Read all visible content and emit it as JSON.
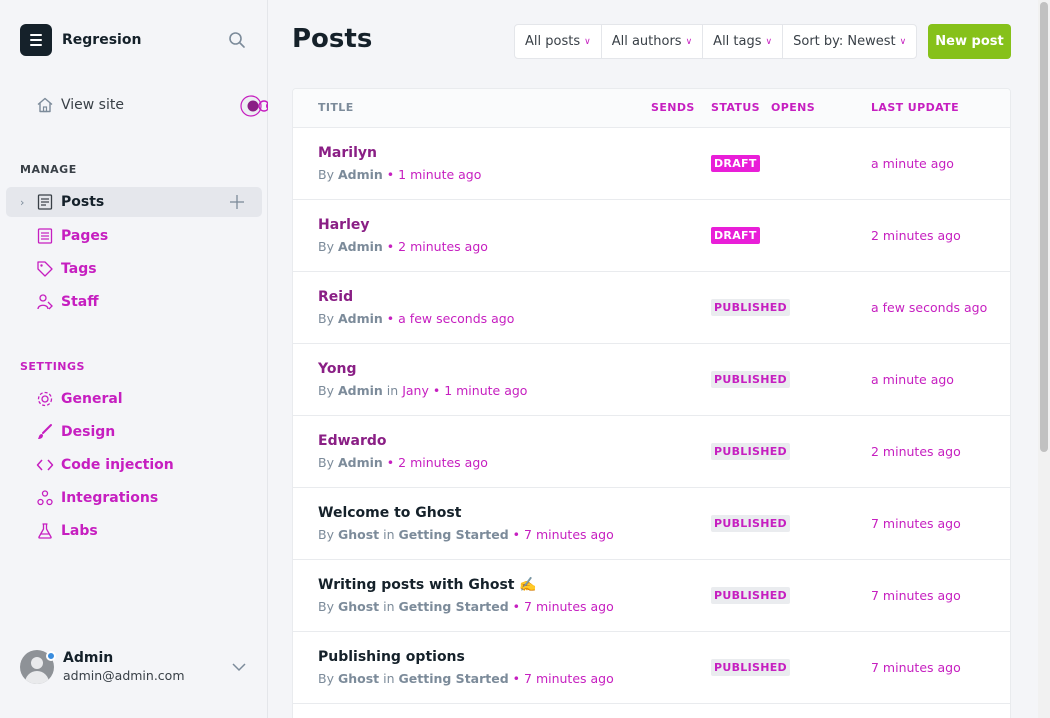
{
  "brand": {
    "name": "Regresion"
  },
  "sidebar": {
    "view_site": "View site",
    "manage_label": "MANAGE",
    "settings_label": "SETTINGS",
    "manage_items": [
      {
        "label": "Posts"
      },
      {
        "label": "Pages"
      },
      {
        "label": "Tags"
      },
      {
        "label": "Staff"
      }
    ],
    "settings_items": [
      {
        "label": "General"
      },
      {
        "label": "Design"
      },
      {
        "label": "Code injection"
      },
      {
        "label": "Integrations"
      },
      {
        "label": "Labs"
      }
    ]
  },
  "user": {
    "name": "Admin",
    "email": "admin@admin.com"
  },
  "main": {
    "title": "Posts",
    "filters": [
      {
        "label": "All posts"
      },
      {
        "label": "All authors"
      },
      {
        "label": "All tags"
      },
      {
        "label": "Sort by: Newest"
      }
    ],
    "new_post_label": "New post",
    "columns": {
      "title": "TITLE",
      "sends": "SENDS",
      "status": "STATUS",
      "opens": "OPENS",
      "last_update": "LAST UPDATE"
    },
    "rows": [
      {
        "title": "Marilyn",
        "author": "Admin",
        "tag": "",
        "time": "1 minute ago",
        "status": "DRAFT",
        "updated": "a minute ago"
      },
      {
        "title": "Harley",
        "author": "Admin",
        "tag": "",
        "time": "2 minutes ago",
        "status": "DRAFT",
        "updated": "2 minutes ago"
      },
      {
        "title": "Reid",
        "author": "Admin",
        "tag": "",
        "time": "a few seconds ago",
        "status": "PUBLISHED",
        "updated": "a few seconds ago"
      },
      {
        "title": "Yong",
        "author": "Admin",
        "tag": "Jany",
        "time": "1 minute ago",
        "status": "PUBLISHED",
        "updated": "a minute ago"
      },
      {
        "title": "Edwardo",
        "author": "Admin",
        "tag": "",
        "time": "2 minutes ago",
        "status": "PUBLISHED",
        "updated": "2 minutes ago"
      },
      {
        "title": "Welcome to Ghost",
        "author": "Ghost",
        "tag": "Getting Started",
        "time": "7 minutes ago",
        "status": "PUBLISHED",
        "updated": "7 minutes ago"
      },
      {
        "title": "Writing posts with Ghost ✍️",
        "author": "Ghost",
        "tag": "Getting Started",
        "time": "7 minutes ago",
        "status": "PUBLISHED",
        "updated": "7 minutes ago"
      },
      {
        "title": "Publishing options",
        "author": "Ghost",
        "tag": "Getting Started",
        "time": "7 minutes ago",
        "status": "PUBLISHED",
        "updated": "7 minutes ago"
      }
    ]
  },
  "strings": {
    "by": "By",
    "in": "in",
    "sep": "•"
  },
  "colors": {
    "accent": "#c61fc0",
    "primary_button": "#86c11a",
    "draft_badge": "#e91ed8",
    "text_dark": "#15212a"
  }
}
